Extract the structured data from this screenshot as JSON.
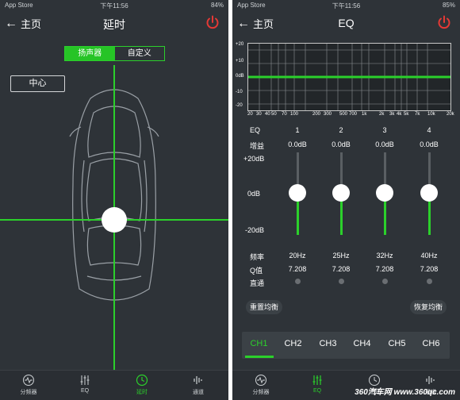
{
  "left": {
    "status": {
      "carrier": "App Store",
      "time": "下午11:56",
      "battery": "84%"
    },
    "nav": {
      "back_label": "主页",
      "title": "延时"
    },
    "segment": {
      "options": [
        "扬声器",
        "自定义"
      ],
      "selected": "扬声器"
    },
    "center_button": "中心",
    "tabs": [
      {
        "label": "分频器",
        "icon": "waveform-circle-icon"
      },
      {
        "label": "EQ",
        "icon": "eq-sliders-icon"
      },
      {
        "label": "延时",
        "icon": "clock-icon",
        "active": true
      },
      {
        "label": "通道",
        "icon": "audio-bars-icon"
      }
    ]
  },
  "right": {
    "status": {
      "carrier": "App Store",
      "time": "下午11:56",
      "battery": "85%"
    },
    "nav": {
      "back_label": "主页",
      "title": "EQ"
    },
    "graph": {
      "y_labels": [
        "+20",
        "+10",
        "0dB",
        "-10",
        "-20"
      ],
      "x_labels": [
        "20",
        "30",
        "40",
        "50",
        "70",
        "100",
        "200",
        "300",
        "500",
        "700",
        "1k",
        "2k",
        "3k",
        "4k",
        "5k",
        "7k",
        "10k",
        "20k"
      ]
    },
    "eq": {
      "label_eq": "EQ",
      "label_gain": "增益",
      "label_plus20": "+20dB",
      "label_zero": "0dB",
      "label_minus20": "-20dB",
      "label_freq": "频率",
      "label_q": "Q值",
      "label_bypass": "直通",
      "bands": [
        {
          "number": "1",
          "gain": "0.0dB",
          "freq": "20Hz",
          "q": "7.208"
        },
        {
          "number": "2",
          "gain": "0.0dB",
          "freq": "25Hz",
          "q": "7.208"
        },
        {
          "number": "3",
          "gain": "0.0dB",
          "freq": "32Hz",
          "q": "7.208"
        },
        {
          "number": "4",
          "gain": "0.0dB",
          "freq": "40Hz",
          "q": "7.208"
        }
      ]
    },
    "buttons": {
      "reset": "重置均衡",
      "restore": "恢复均衡"
    },
    "channels": [
      "CH1",
      "CH2",
      "CH3",
      "CH4",
      "CH5",
      "CH6"
    ],
    "tabs": [
      {
        "label": "分频器",
        "icon": "waveform-circle-icon"
      },
      {
        "label": "EQ",
        "icon": "eq-sliders-icon",
        "active": true
      },
      {
        "label": "延时",
        "icon": "clock-icon"
      },
      {
        "label": "通道",
        "icon": "audio-bars-icon"
      }
    ],
    "watermark": "360汽车网 www.360qc.com"
  },
  "colors": {
    "accent": "#2bd02b",
    "background": "#2e3338",
    "power": "#e53935"
  }
}
